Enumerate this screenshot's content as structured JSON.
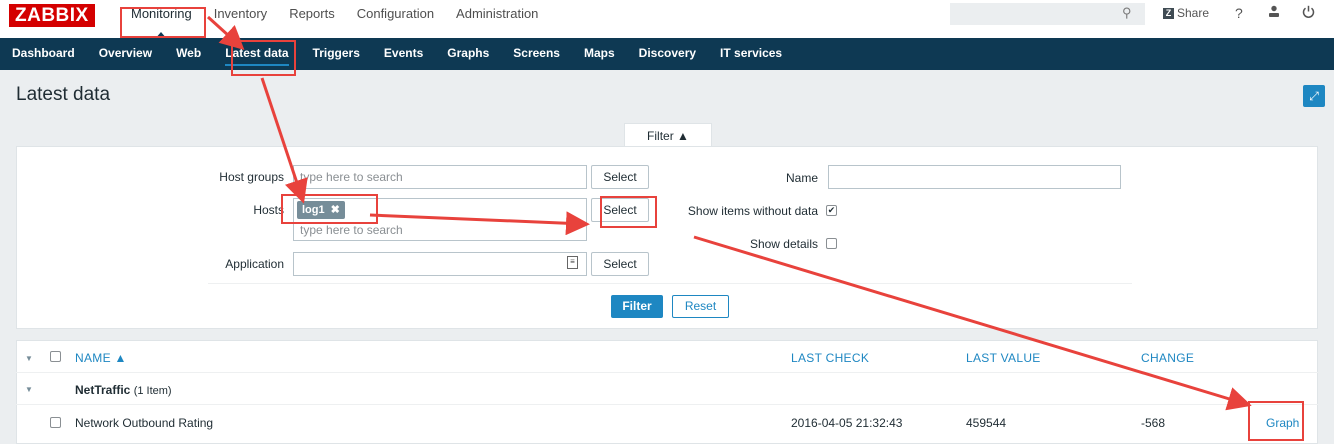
{
  "header": {
    "logo": "ZABBIX",
    "main_menu": [
      "Monitoring",
      "Inventory",
      "Reports",
      "Configuration",
      "Administration"
    ],
    "share_badge": "Z",
    "share_label": "Share",
    "help": "?",
    "user_icon": "user-icon",
    "power_icon": "power-icon",
    "search_icon": "search-icon"
  },
  "subnav": [
    "Dashboard",
    "Overview",
    "Web",
    "Latest data",
    "Triggers",
    "Events",
    "Graphs",
    "Screens",
    "Maps",
    "Discovery",
    "IT services"
  ],
  "page": {
    "title": "Latest data"
  },
  "filter": {
    "tab_label": "Filter ▲",
    "host_groups_label": "Host groups",
    "host_groups_placeholder": "type here to search",
    "hosts_label": "Hosts",
    "hosts_chip": "log1",
    "hosts_chip_remove": "✖",
    "hosts_placeholder": "type here to search",
    "application_label": "Application",
    "select_label": "Select",
    "name_label": "Name",
    "name_value": "",
    "show_items_without_data_label": "Show items without data",
    "show_items_without_data_checked": true,
    "show_details_label": "Show details",
    "show_details_checked": false,
    "check_mark": "✔",
    "filter_button": "Filter",
    "reset_button": "Reset"
  },
  "table": {
    "headers": {
      "name": "NAME ▲",
      "last_check": "LAST CHECK",
      "last_value": "LAST VALUE",
      "change": "CHANGE"
    },
    "group": {
      "name": "NetTraffic",
      "count": "(1 Item)"
    },
    "rows": [
      {
        "name": "Network Outbound Rating",
        "last_check": "2016-04-05 21:32:43",
        "last_value": "459544",
        "change": "-568",
        "action": "Graph"
      }
    ]
  },
  "annotations": {
    "color": "#e8423c"
  },
  "colors": {
    "brand": "#d40000",
    "nav": "#0e3953",
    "accent": "#1e87c2"
  }
}
